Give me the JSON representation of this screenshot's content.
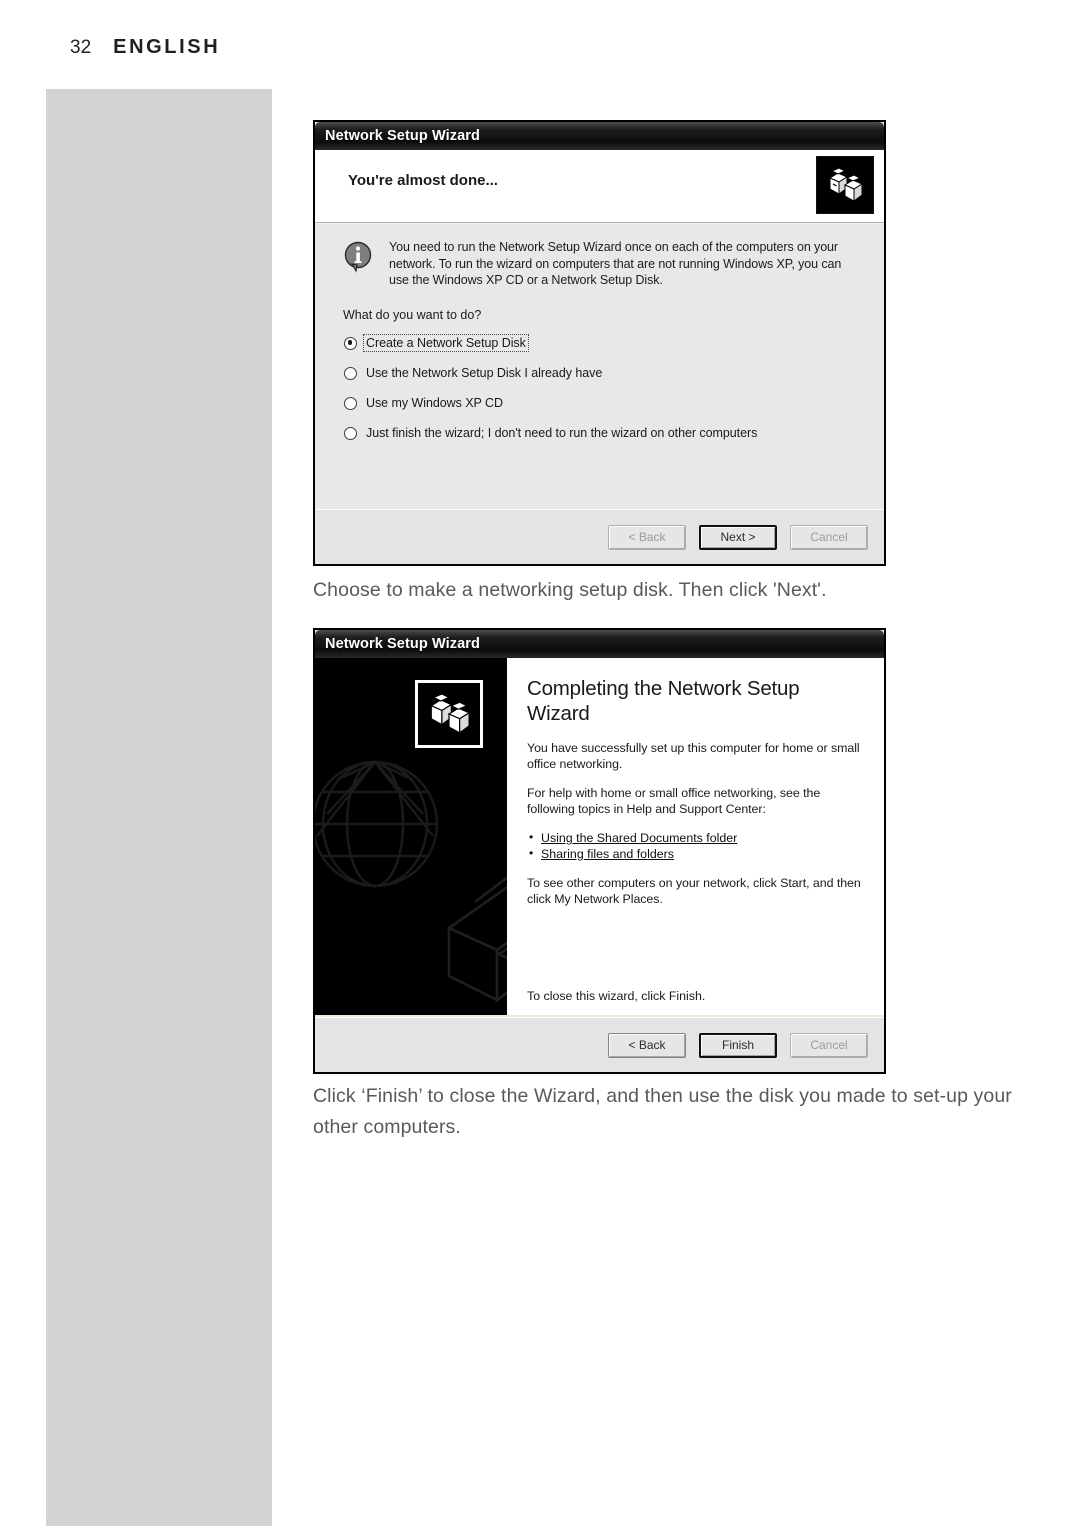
{
  "page": {
    "number": "32",
    "language": "ENGLISH",
    "band_color": "#d2d3d4",
    "caption_color": "#58595b"
  },
  "dialog_one": {
    "title": "Network Setup Wizard",
    "heading": "You're almost done...",
    "header_icon": "network-computers-icon",
    "info_icon": "information-icon",
    "info_text": "You need to run the Network Setup Wizard once on each of the computers on your network. To run the wizard on computers that are not running Windows XP, you can use the Windows XP CD or a Network Setup Disk.",
    "question": "What do you want to do?",
    "options": [
      {
        "label": "Create a Network Setup Disk",
        "selected": true
      },
      {
        "label": "Use the Network Setup Disk I already have",
        "selected": false
      },
      {
        "label": "Use my Windows XP CD",
        "selected": false
      },
      {
        "label": "Just finish the wizard; I don't need to run the wizard on other computers",
        "selected": false
      }
    ],
    "buttons": {
      "back": "< Back",
      "next": "Next >",
      "cancel": "Cancel",
      "default": "next",
      "disabled": [
        "back",
        "cancel"
      ]
    }
  },
  "caption_one": "Choose to make a networking setup disk. Then click 'Next'.",
  "dialog_two": {
    "title": "Network Setup Wizard",
    "heading": "Completing the Network Setup Wizard",
    "art_icon": "network-computers-icon",
    "watermarks": [
      "globe-icon",
      "printer-icon",
      "folder-documents-icon"
    ],
    "paragraphs": [
      "You have successfully set up this computer for home or small office networking.",
      "For help with home or small office networking, see the following topics in Help and Support Center:"
    ],
    "links": [
      "Using the Shared Documents folder",
      "Sharing files and folders"
    ],
    "paragraph_after_links": "To see other computers on your network, click Start, and then click My Network Places.",
    "close_note": "To close this wizard, click Finish.",
    "buttons": {
      "back": "< Back",
      "finish": "Finish",
      "cancel": "Cancel",
      "default": "finish",
      "disabled": [
        "cancel"
      ]
    }
  },
  "caption_two": "Click ‘Finish’ to close the Wizard, and then use the disk you made to set-up your other computers."
}
